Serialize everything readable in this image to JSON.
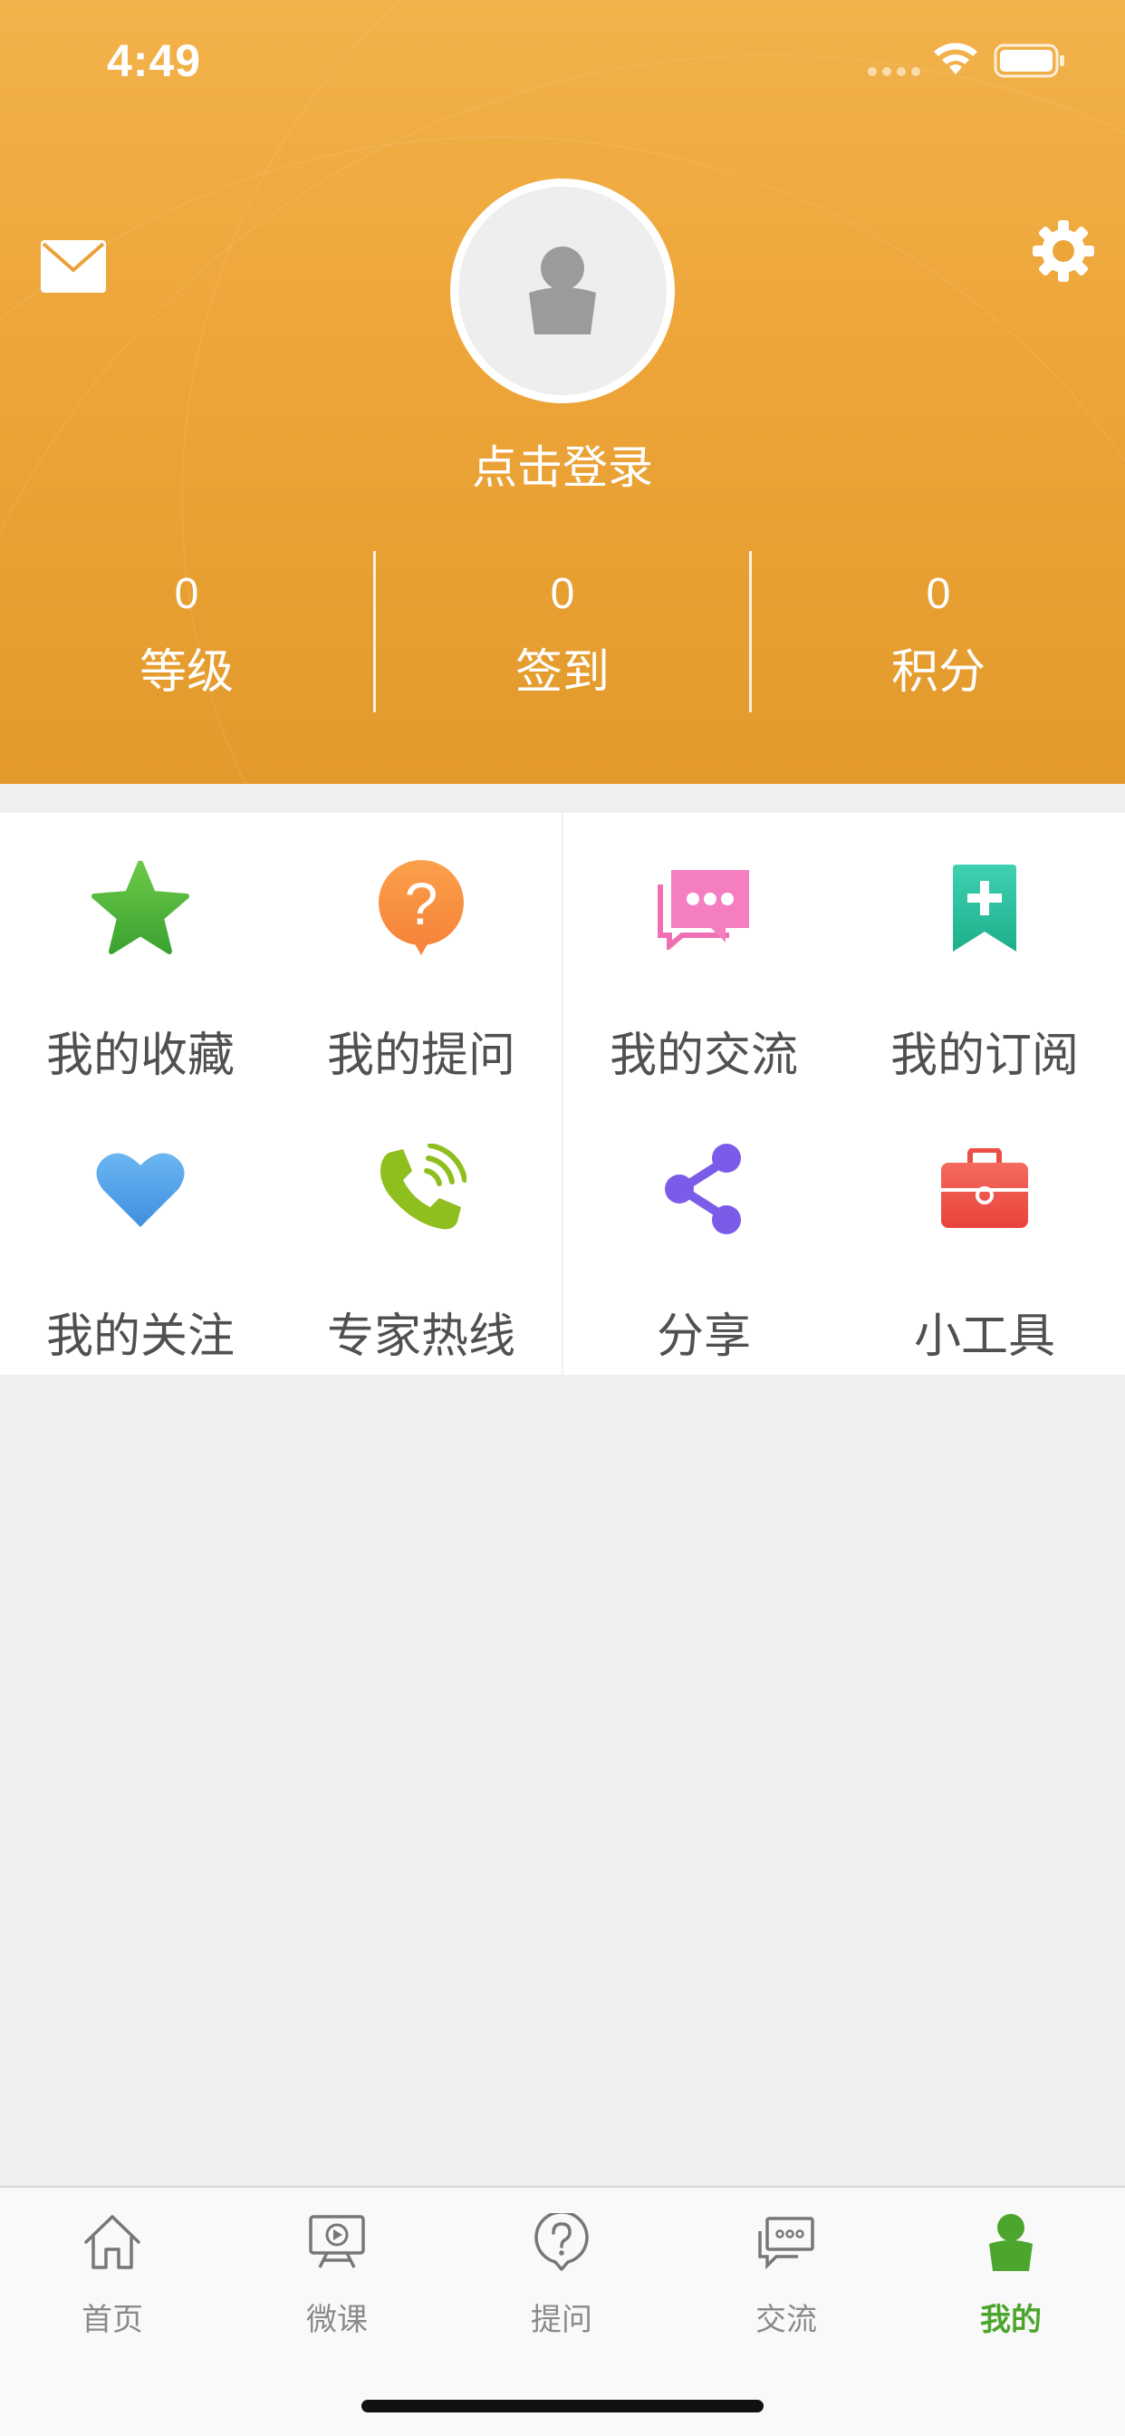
{
  "status": {
    "time": "4:49"
  },
  "profile": {
    "login_text": "点击登录",
    "stats": [
      {
        "value": "0",
        "label": "等级"
      },
      {
        "value": "0",
        "label": "签到"
      },
      {
        "value": "0",
        "label": "积分"
      }
    ]
  },
  "menu": [
    {
      "label": "我的收藏",
      "icon": "star-icon",
      "color": "#4db33c"
    },
    {
      "label": "我的提问",
      "icon": "question-bubble-icon",
      "color": "#f79a3e"
    },
    {
      "label": "我的交流",
      "icon": "chat-bubbles-icon",
      "color": "#f06fb4"
    },
    {
      "label": "我的订阅",
      "icon": "bookmark-plus-icon",
      "color": "#2bbf9e"
    },
    {
      "label": "我的关注",
      "icon": "heart-icon",
      "color": "#4a9fe8"
    },
    {
      "label": "专家热线",
      "icon": "phone-icon",
      "color": "#8ebf1e"
    },
    {
      "label": "分享",
      "icon": "share-icon",
      "color": "#7b5ce8"
    },
    {
      "label": "小工具",
      "icon": "toolbox-icon",
      "color": "#ef5350"
    }
  ],
  "tabbar": {
    "active_color": "#4ca52d",
    "items": [
      {
        "label": "首页",
        "icon": "home-icon"
      },
      {
        "label": "微课",
        "icon": "video-board-icon"
      },
      {
        "label": "提问",
        "icon": "question-icon"
      },
      {
        "label": "交流",
        "icon": "chat-icon"
      },
      {
        "label": "我的",
        "icon": "user-icon",
        "active": true
      }
    ]
  }
}
